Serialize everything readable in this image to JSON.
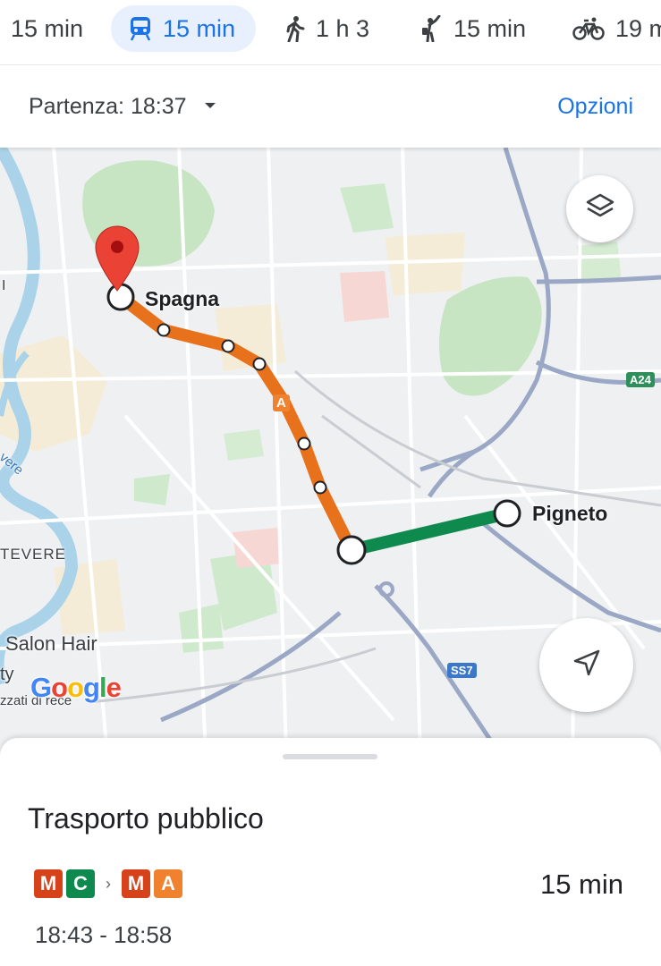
{
  "mode_tabs": [
    {
      "id": "drive",
      "label": "15 min",
      "icon": "car-icon",
      "active": false
    },
    {
      "id": "transit",
      "label": "15 min",
      "icon": "train-icon",
      "active": true
    },
    {
      "id": "walk",
      "label": "1 h 3",
      "icon": "walk-icon",
      "active": false
    },
    {
      "id": "ride",
      "label": "15 min",
      "icon": "ride-hail-icon",
      "active": false
    },
    {
      "id": "bike",
      "label": "19 m",
      "icon": "bike-icon",
      "active": false
    }
  ],
  "departure": {
    "label": "Partenza: 18:37",
    "options_label": "Opzioni"
  },
  "map": {
    "origin_label": "Spagna",
    "destination_label": "Pigneto",
    "line_badge": "A",
    "road_shield_a24": "A24",
    "road_shield_ss7": "SS7",
    "poi_salon": "Salon Hair",
    "area_tevere": "TEVERE",
    "area_tevere_side": "vere",
    "fragment_ty": "ty",
    "fragment_zzati": "zzati di rece",
    "fragment_i": "I",
    "google_logo": "Google",
    "metro_a_color": "#e8711c",
    "metro_c_color": "#0f8a4f",
    "pin_color": "#ea4335"
  },
  "sheet": {
    "title": "Trasporto pubblico",
    "route_badges": [
      {
        "text": "M",
        "color": "#d6421a"
      },
      {
        "text": "C",
        "color": "#0f8a4f"
      },
      {
        "text": "M",
        "color": "#d6421a"
      },
      {
        "text": "A",
        "color": "#f0812e"
      }
    ],
    "separator": "›",
    "duration": "15 min",
    "times": "18:43 - 18:58"
  }
}
